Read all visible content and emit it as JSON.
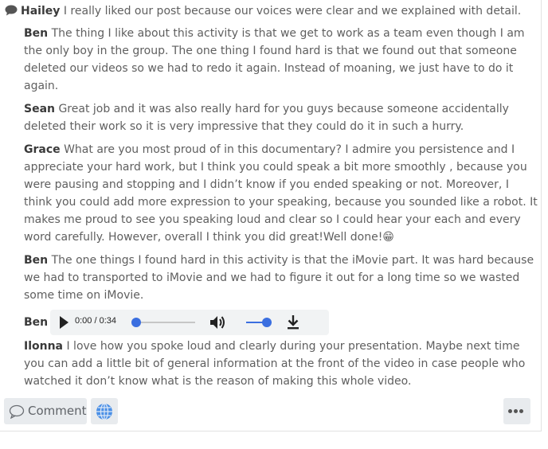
{
  "comments": [
    {
      "author": "Hailey",
      "text": "I really liked our post because our voices were clear and we explained with detail."
    },
    {
      "author": "Ben",
      "text": "The thing I like about this activity is that we get to work as a team even though I am the only boy in the group. The one thing I found hard is that we found out that someone deleted our videos so we had to redo it again. Instead of moaning, we just have to do it again."
    },
    {
      "author": "Sean",
      "text": "Great job and it was also really hard for you guys because someone accidentally deleted their work so it is very impressive that they could do it in such a hurry."
    },
    {
      "author": "Grace",
      "text": "What are you most proud of in this documentary? I admire you persistence and I appreciate your hard work, but I think you could speak a bit more smoothly , because you were pausing and stopping and I didn’t know if you ended speaking or not. Moreover, I think you could add more expression to your speaking, because you sounded like a robot. It makes me proud to see you speaking loud and clear so I could hear your each and every word carefully. However, overall I think you did great!Well done!😁"
    },
    {
      "author": "Ben",
      "text": "The one things I found hard in this activity is that the iMovie part. It was hard because we had to transported to iMovie and we had to figure it out for a long time so we wasted some time on iMovie."
    },
    {
      "author": "Ilonna",
      "text": "I love how you spoke loud and clearly during your presentation. Maybe next time you can add a little bit of general information at the front of the video in case people who watched it don’t know what is the reason of making this whole video."
    }
  ],
  "audio_comment": {
    "author": "Ben",
    "time": "0:00 / 0:34",
    "progress": 0.0,
    "volume": 1.0
  },
  "footer": {
    "comment_label": "Comment"
  },
  "icons": {
    "comment_bubble": "speech-bubble-icon",
    "globe": "globe-icon",
    "more": "more-dots-icon"
  },
  "colors": {
    "accent": "#3b6fe0",
    "author": "#3a3a3a",
    "text": "#5f5f5f",
    "button_bg": "#e8ebee"
  }
}
